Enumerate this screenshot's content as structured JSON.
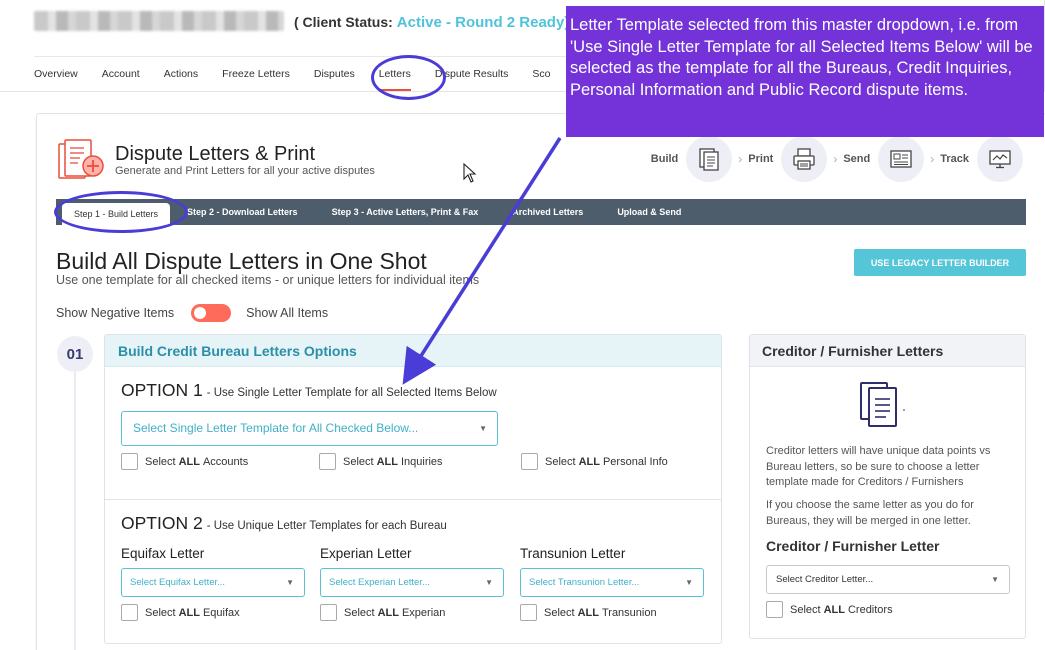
{
  "header": {
    "client_status_label": "( Client Status:",
    "client_status_value": "Active - Round 2 Ready)"
  },
  "nav": {
    "items": [
      {
        "label": "Overview"
      },
      {
        "label": "Account"
      },
      {
        "label": "Actions"
      },
      {
        "label": "Freeze Letters"
      },
      {
        "label": "Disputes"
      },
      {
        "label": "Letters",
        "active": true
      },
      {
        "label": "Dispute Results"
      },
      {
        "label": "Sco"
      }
    ]
  },
  "page": {
    "title": "Dispute Letters & Print",
    "subtitle": "Generate and Print Letters for all your active disputes"
  },
  "workflow": {
    "steps": [
      {
        "label": "Build",
        "icon": "document-stack-icon"
      },
      {
        "label": "Print",
        "icon": "printer-icon"
      },
      {
        "label": "Send",
        "icon": "newspaper-icon"
      },
      {
        "label": "Track",
        "icon": "monitor-chart-icon"
      }
    ]
  },
  "steps_bar": {
    "tabs": [
      {
        "label": "Step 1 - Build Letters",
        "active": true
      },
      {
        "label": "Step 2 - Download Letters"
      },
      {
        "label": "Step 3 - Active Letters, Print & Fax"
      },
      {
        "label": "Archived Letters"
      },
      {
        "label": "Upload & Send"
      }
    ]
  },
  "build": {
    "title": "Build All Dispute Letters in One Shot",
    "subtitle": "Use one template for all checked items - or unique letters for individual items",
    "legacy_button": "USE LEGACY LETTER BUILDER",
    "toggle_left": "Show Negative Items",
    "toggle_right": "Show All Items",
    "step_number": "01"
  },
  "bureau_panel": {
    "title": "Build Credit Bureau Letters Options",
    "option1": {
      "title": "OPTION 1",
      "desc": "- Use Single Letter Template for all Selected Items Below",
      "select_placeholder": "Select Single Letter Template for All Checked Below...",
      "checks": [
        {
          "pre": "Select",
          "bold": "ALL",
          "post": "Accounts"
        },
        {
          "pre": "Select",
          "bold": "ALL",
          "post": "Inquiries"
        },
        {
          "pre": "Select",
          "bold": "ALL",
          "post": "Personal Info"
        }
      ]
    },
    "option2": {
      "title": "OPTION 2",
      "desc": "- Use Unique Letter Templates for each Bureau",
      "bureaus": [
        {
          "label": "Equifax Letter",
          "placeholder": "Select Equifax Letter...",
          "check_pre": "Select",
          "check_bold": "ALL",
          "check_post": "Equifax"
        },
        {
          "label": "Experian Letter",
          "placeholder": "Select Experian Letter...",
          "check_pre": "Select",
          "check_bold": "ALL",
          "check_post": "Experian"
        },
        {
          "label": "Transunion Letter",
          "placeholder": "Select Transunion Letter...",
          "check_pre": "Select",
          "check_bold": "ALL",
          "check_post": "Transunion"
        }
      ]
    }
  },
  "creditor_panel": {
    "title": "Creditor / Furnisher Letters",
    "text1": "Creditor letters will have unique data points vs Bureau letters, so be sure to choose a letter template made for Creditors / Furnishers",
    "text2": "If you choose the same letter as you do for Bureaus, they will be merged in one letter.",
    "label": "Creditor / Furnisher Letter",
    "select_placeholder": "Select Creditor Letter...",
    "check_pre": "Select",
    "check_bold": "ALL",
    "check_post": "Creditors"
  },
  "annotation": {
    "text": "Letter Template selected from this master dropdown, i.e. from 'Use Single Letter Template for all Selected Items Below' will be selected as the template for all the Bureaus, Credit Inquiries, Personal Information and Public Record dispute items.",
    "color": "#7333d9",
    "ring_color": "#4a3cd6"
  },
  "colors": {
    "accent_teal": "#55c5d8",
    "toggle_red": "#ff6b5b",
    "steps_bar": "#4e5d6c"
  }
}
